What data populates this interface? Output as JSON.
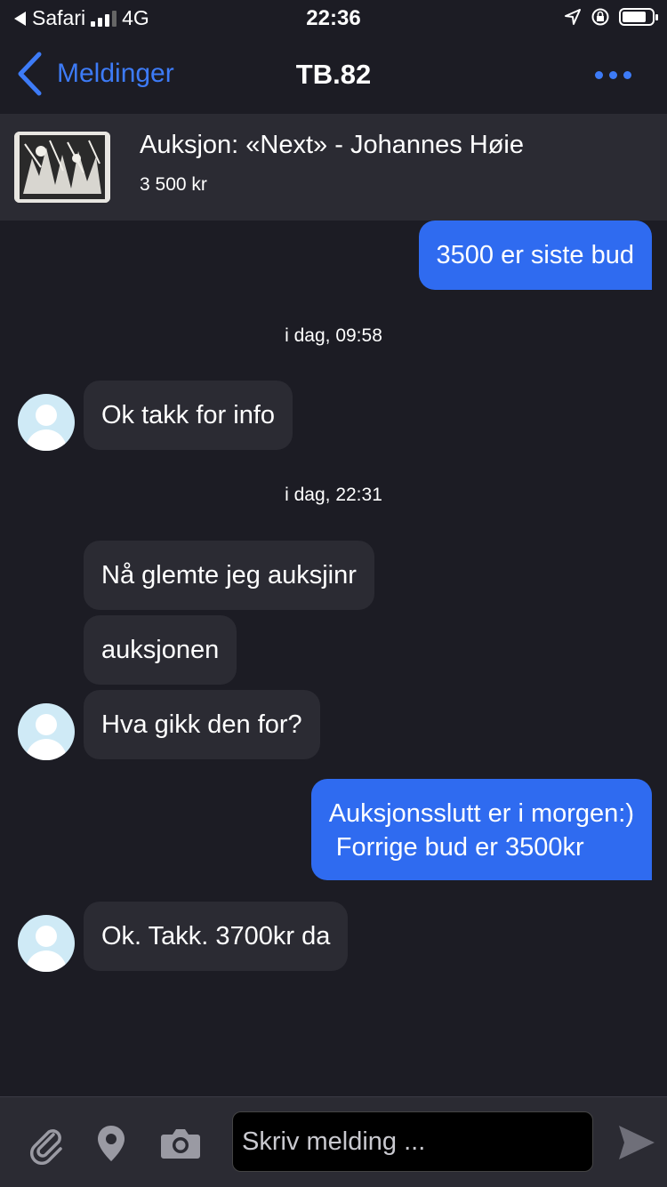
{
  "status_bar": {
    "back_app": "Safari",
    "network": "4G",
    "time": "22:36"
  },
  "nav": {
    "back_label": "Meldinger",
    "title": "TB.82"
  },
  "listing": {
    "title": "Auksjon: «Next» - Johannes Høie",
    "price": "3 500 kr"
  },
  "messages": [
    {
      "direction": "out",
      "text": "3500 er siste bud"
    },
    {
      "type": "timestamp",
      "text": "i dag, 09:58"
    },
    {
      "direction": "in",
      "text": "Ok takk for info"
    },
    {
      "type": "timestamp",
      "text": "i dag, 22:31"
    },
    {
      "direction": "in",
      "text": "Nå glemte jeg auksjinr"
    },
    {
      "direction": "in",
      "text": "auksjonen"
    },
    {
      "direction": "in",
      "text": "Hva gikk den for?"
    },
    {
      "direction": "out",
      "text": "Auksjonsslutt er i morgen:)\n Forrige bud er 3500kr"
    },
    {
      "direction": "in",
      "text": "Ok. Takk. 3700kr da"
    }
  ],
  "composer": {
    "placeholder": "Skriv melding ..."
  },
  "colors": {
    "background": "#1c1c24",
    "accent": "#3d7bf7",
    "outgoing_bubble": "#2f6bf0",
    "incoming_bubble": "#2b2b33",
    "avatar": "#cfeaf6"
  },
  "icons": [
    "back-arrow-icon",
    "more-icon",
    "location-arrow-icon",
    "orientation-lock-icon",
    "battery-icon",
    "paperclip-icon",
    "location-pin-icon",
    "camera-icon",
    "send-icon",
    "avatar-icon"
  ]
}
